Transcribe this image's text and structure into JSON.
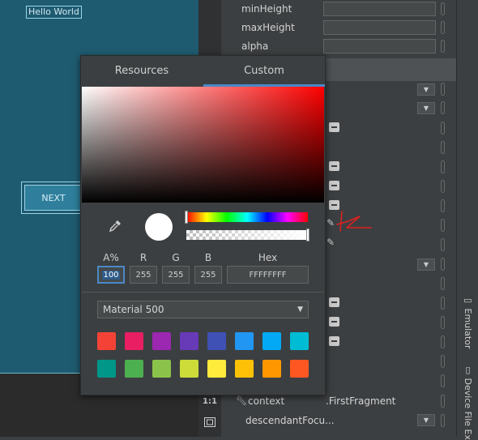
{
  "canvas": {
    "hello_text": "Hello World",
    "button_text": "NEXT"
  },
  "tool_strip": {
    "ratio_label": "1:1"
  },
  "attributes": {
    "rows": [
      {
        "label": "minHeight",
        "value": ""
      },
      {
        "label": "maxHeight",
        "value": ""
      },
      {
        "label": "alpha",
        "value": ""
      },
      {
        "label": "context",
        "value": ".FirstFragment"
      },
      {
        "label": "descendantFocu...",
        "value": ""
      }
    ]
  },
  "side_panels": {
    "emulator": "Emulator",
    "device_file": "Device File Ex"
  },
  "color_picker": {
    "tabs": [
      "Resources",
      "Custom"
    ],
    "active_tab": "Custom",
    "channel_labels": [
      "A%",
      "R",
      "G",
      "B",
      "Hex"
    ],
    "alpha": "100",
    "r": "255",
    "g": "255",
    "b": "255",
    "hex": "FFFFFFFF",
    "palette_name": "Material 500",
    "colors": {
      "accent": "#4a88c7",
      "preview": "#ffffff"
    },
    "swatches": [
      "#f44336",
      "#e91e63",
      "#9c27b0",
      "#673ab7",
      "#3f51b5",
      "#2196f3",
      "#03a9f4",
      "#00bcd4",
      "#009688",
      "#4caf50",
      "#8bc34a",
      "#cddc39",
      "#ffeb3b",
      "#ffc107",
      "#ff9800",
      "#ff5722"
    ]
  }
}
